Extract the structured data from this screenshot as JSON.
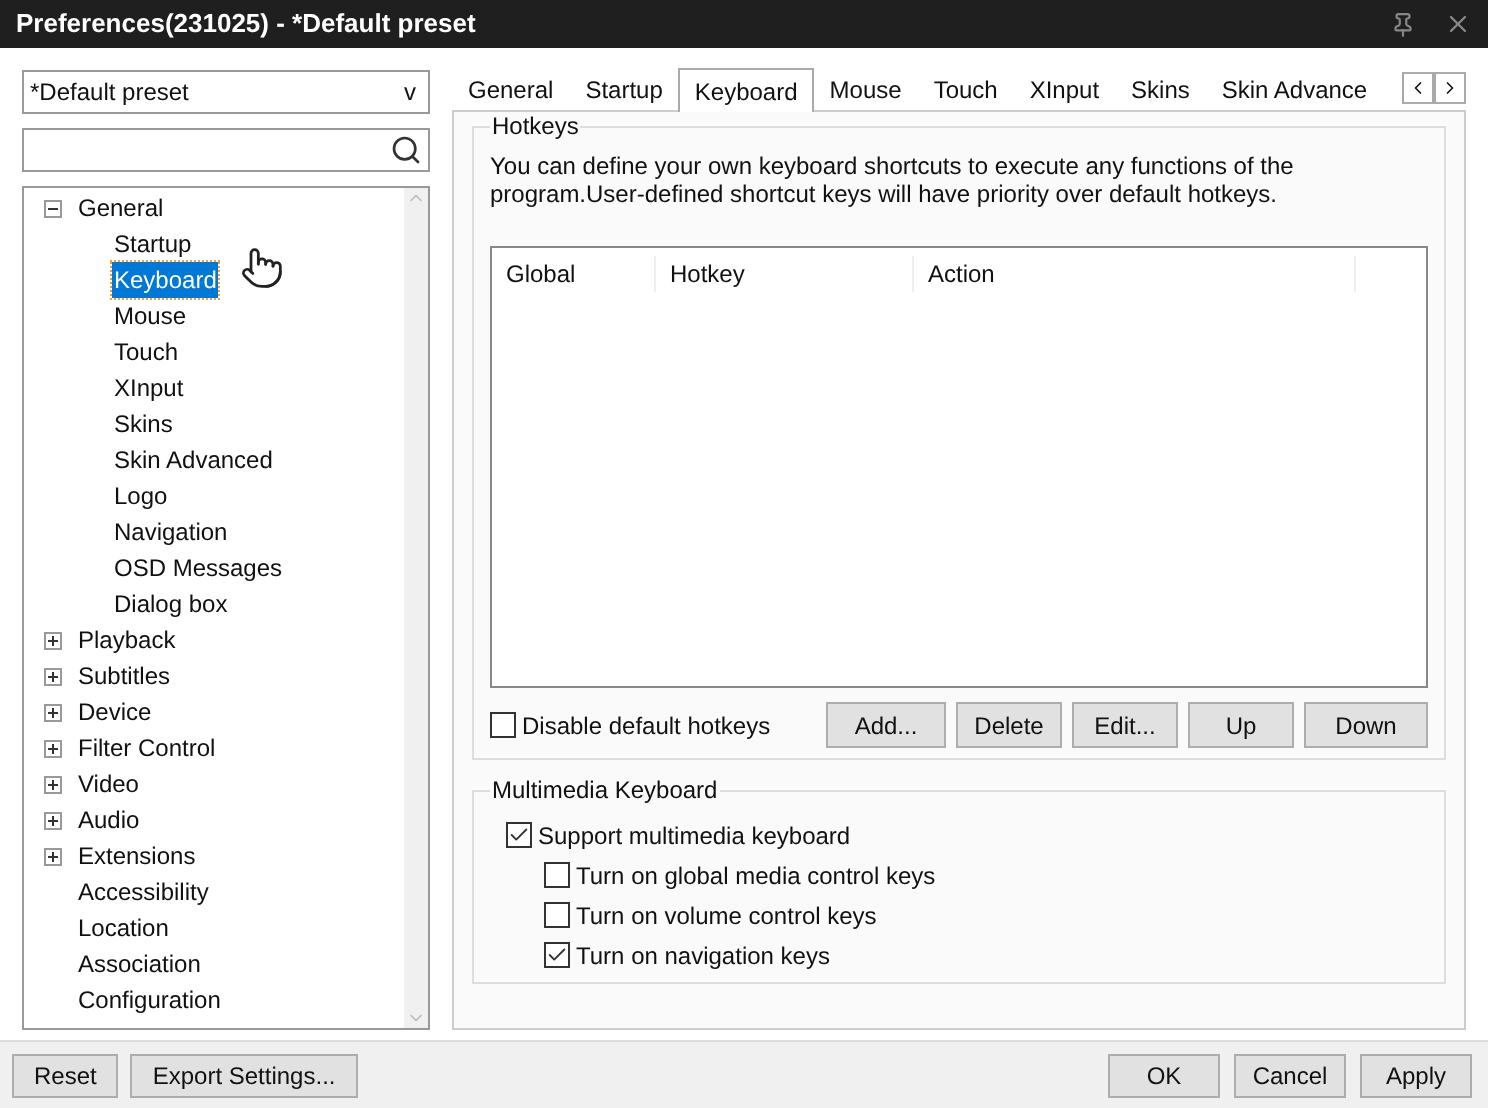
{
  "window": {
    "title": "Preferences(231025) - *Default preset"
  },
  "preset_dropdown": {
    "value": "*Default preset",
    "caret": "v"
  },
  "tree": [
    {
      "label": "General",
      "expanded": true,
      "selected": false,
      "children": [
        {
          "label": "Startup",
          "selected": false
        },
        {
          "label": "Keyboard",
          "selected": true
        },
        {
          "label": "Mouse",
          "selected": false
        },
        {
          "label": "Touch",
          "selected": false
        },
        {
          "label": "XInput",
          "selected": false
        },
        {
          "label": "Skins",
          "selected": false
        },
        {
          "label": "Skin Advanced",
          "selected": false
        },
        {
          "label": "Logo",
          "selected": false
        },
        {
          "label": "Navigation",
          "selected": false
        },
        {
          "label": "OSD Messages",
          "selected": false
        },
        {
          "label": "Dialog box",
          "selected": false
        }
      ]
    },
    {
      "label": "Playback",
      "expanded": false,
      "selected": false
    },
    {
      "label": "Subtitles",
      "expanded": false,
      "selected": false
    },
    {
      "label": "Device",
      "expanded": false,
      "selected": false
    },
    {
      "label": "Filter Control",
      "expanded": false,
      "selected": false
    },
    {
      "label": "Video",
      "expanded": false,
      "selected": false
    },
    {
      "label": "Audio",
      "expanded": false,
      "selected": false
    },
    {
      "label": "Extensions",
      "expanded": false,
      "selected": false
    },
    {
      "label": "Accessibility",
      "selected": false
    },
    {
      "label": "Location",
      "selected": false
    },
    {
      "label": "Association",
      "selected": false
    },
    {
      "label": "Configuration",
      "selected": false
    }
  ],
  "tabs": [
    {
      "label": "General",
      "selected": false
    },
    {
      "label": "Startup",
      "selected": false
    },
    {
      "label": "Keyboard",
      "selected": true
    },
    {
      "label": "Mouse",
      "selected": false
    },
    {
      "label": "Touch",
      "selected": false
    },
    {
      "label": "XInput",
      "selected": false
    },
    {
      "label": "Skins",
      "selected": false
    },
    {
      "label": "Skin Advance",
      "selected": false
    }
  ],
  "hotkeys": {
    "title": "Hotkeys",
    "description": "You can define your own keyboard shortcuts to execute any functions of the program.User-defined shortcut keys will have priority over default hotkeys.",
    "columns": [
      "Global",
      "Hotkey",
      "Action"
    ],
    "disable_default": {
      "label": "Disable default hotkeys",
      "checked": false
    },
    "buttons": [
      "Add...",
      "Delete",
      "Edit...",
      "Up",
      "Down"
    ]
  },
  "multimedia": {
    "title": "Multimedia Keyboard",
    "options": [
      {
        "label": "Support multimedia keyboard",
        "checked": true,
        "children": [
          {
            "label": "Turn on global media control keys",
            "checked": false
          },
          {
            "label": "Turn on volume control keys",
            "checked": false
          },
          {
            "label": "Turn on navigation keys",
            "checked": true
          }
        ]
      }
    ]
  },
  "footer": {
    "left_buttons": [
      "Reset",
      "Export Settings..."
    ],
    "right_buttons": [
      "OK",
      "Cancel",
      "Apply"
    ]
  }
}
